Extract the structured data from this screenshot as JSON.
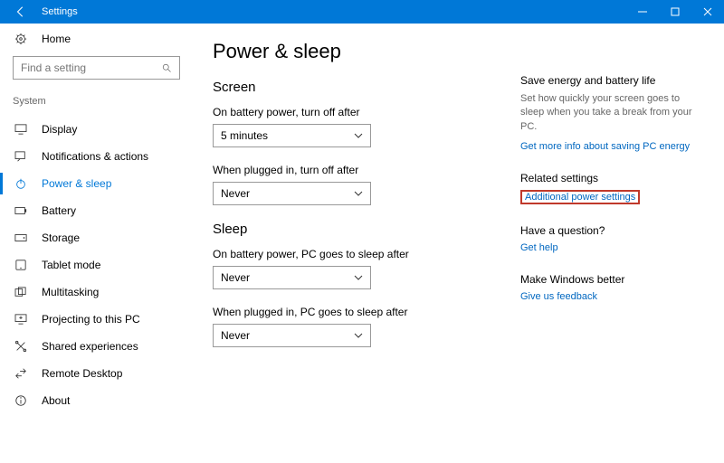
{
  "titlebar": {
    "label": "Settings"
  },
  "home": {
    "label": "Home"
  },
  "search": {
    "placeholder": "Find a setting"
  },
  "section_label": "System",
  "nav": [
    {
      "label": "Display"
    },
    {
      "label": "Notifications & actions"
    },
    {
      "label": "Power & sleep"
    },
    {
      "label": "Battery"
    },
    {
      "label": "Storage"
    },
    {
      "label": "Tablet mode"
    },
    {
      "label": "Multitasking"
    },
    {
      "label": "Projecting to this PC"
    },
    {
      "label": "Shared experiences"
    },
    {
      "label": "Remote Desktop"
    },
    {
      "label": "About"
    }
  ],
  "page": {
    "title": "Power & sleep",
    "screen": {
      "heading": "Screen",
      "battery_label": "On battery power, turn off after",
      "battery_value": "5 minutes",
      "plugged_label": "When plugged in, turn off after",
      "plugged_value": "Never"
    },
    "sleep": {
      "heading": "Sleep",
      "battery_label": "On battery power, PC goes to sleep after",
      "battery_value": "Never",
      "plugged_label": "When plugged in, PC goes to sleep after",
      "plugged_value": "Never"
    }
  },
  "right": {
    "energy_head": "Save energy and battery life",
    "energy_text": "Set how quickly your screen goes to sleep when you take a break from your PC.",
    "energy_link": "Get more info about saving PC energy",
    "related_head": "Related settings",
    "related_link": "Additional power settings",
    "question_head": "Have a question?",
    "question_link": "Get help",
    "better_head": "Make Windows better",
    "better_link": "Give us feedback"
  }
}
